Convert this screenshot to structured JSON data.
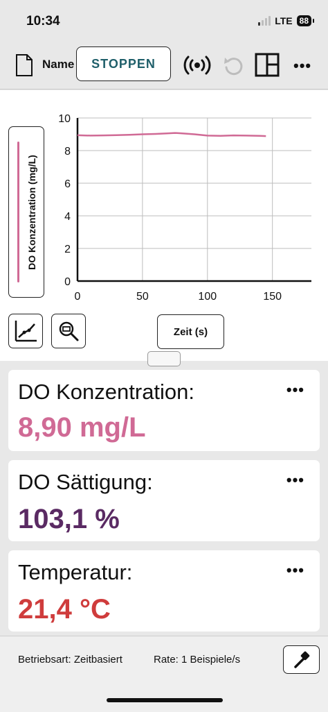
{
  "status_bar": {
    "time": "10:34",
    "network": "LTE",
    "battery": "88"
  },
  "toolbar": {
    "file_name": "Name",
    "stop_label": "STOPPEN",
    "icons": [
      "file-icon",
      "sensor-icon",
      "undo-icon",
      "layout-icon",
      "more-icon"
    ]
  },
  "graph": {
    "ylabel": "DO Konzentration (mg/L)",
    "xlabel_button": "Zeit (s)",
    "series_color": "#d06a95"
  },
  "chart_data": {
    "type": "line",
    "xlabel": "Zeit (s)",
    "ylabel": "DO Konzentration (mg/L)",
    "xlim": [
      0,
      180
    ],
    "ylim": [
      0,
      10
    ],
    "x_ticks": [
      "0",
      "50",
      "100",
      "150"
    ],
    "y_ticks": [
      "0",
      "2",
      "4",
      "6",
      "8",
      "10"
    ],
    "grid": true,
    "series": [
      {
        "name": "DO Konzentration",
        "x": [
          0,
          10,
          20,
          30,
          40,
          50,
          60,
          70,
          75,
          80,
          90,
          100,
          110,
          120,
          130,
          140,
          145
        ],
        "y": [
          8.94,
          8.92,
          8.93,
          8.95,
          8.97,
          9.0,
          9.02,
          9.06,
          9.08,
          9.06,
          9.0,
          8.92,
          8.9,
          8.93,
          8.92,
          8.9,
          8.89
        ]
      }
    ]
  },
  "meters": [
    {
      "label": "DO Konzentration:",
      "value": "8,90 mg/L",
      "color": "#d06a95"
    },
    {
      "label": "DO Sättigung:",
      "value": "103,1 %",
      "color": "#5a2a63"
    },
    {
      "label": "Temperatur:",
      "value": "21,4 °C",
      "color": "#cf3c3c"
    }
  ],
  "bottom_bar": {
    "mode": "Betriebsart: Zeitbasiert",
    "rate": "Rate: 1 Beispiele/s"
  }
}
